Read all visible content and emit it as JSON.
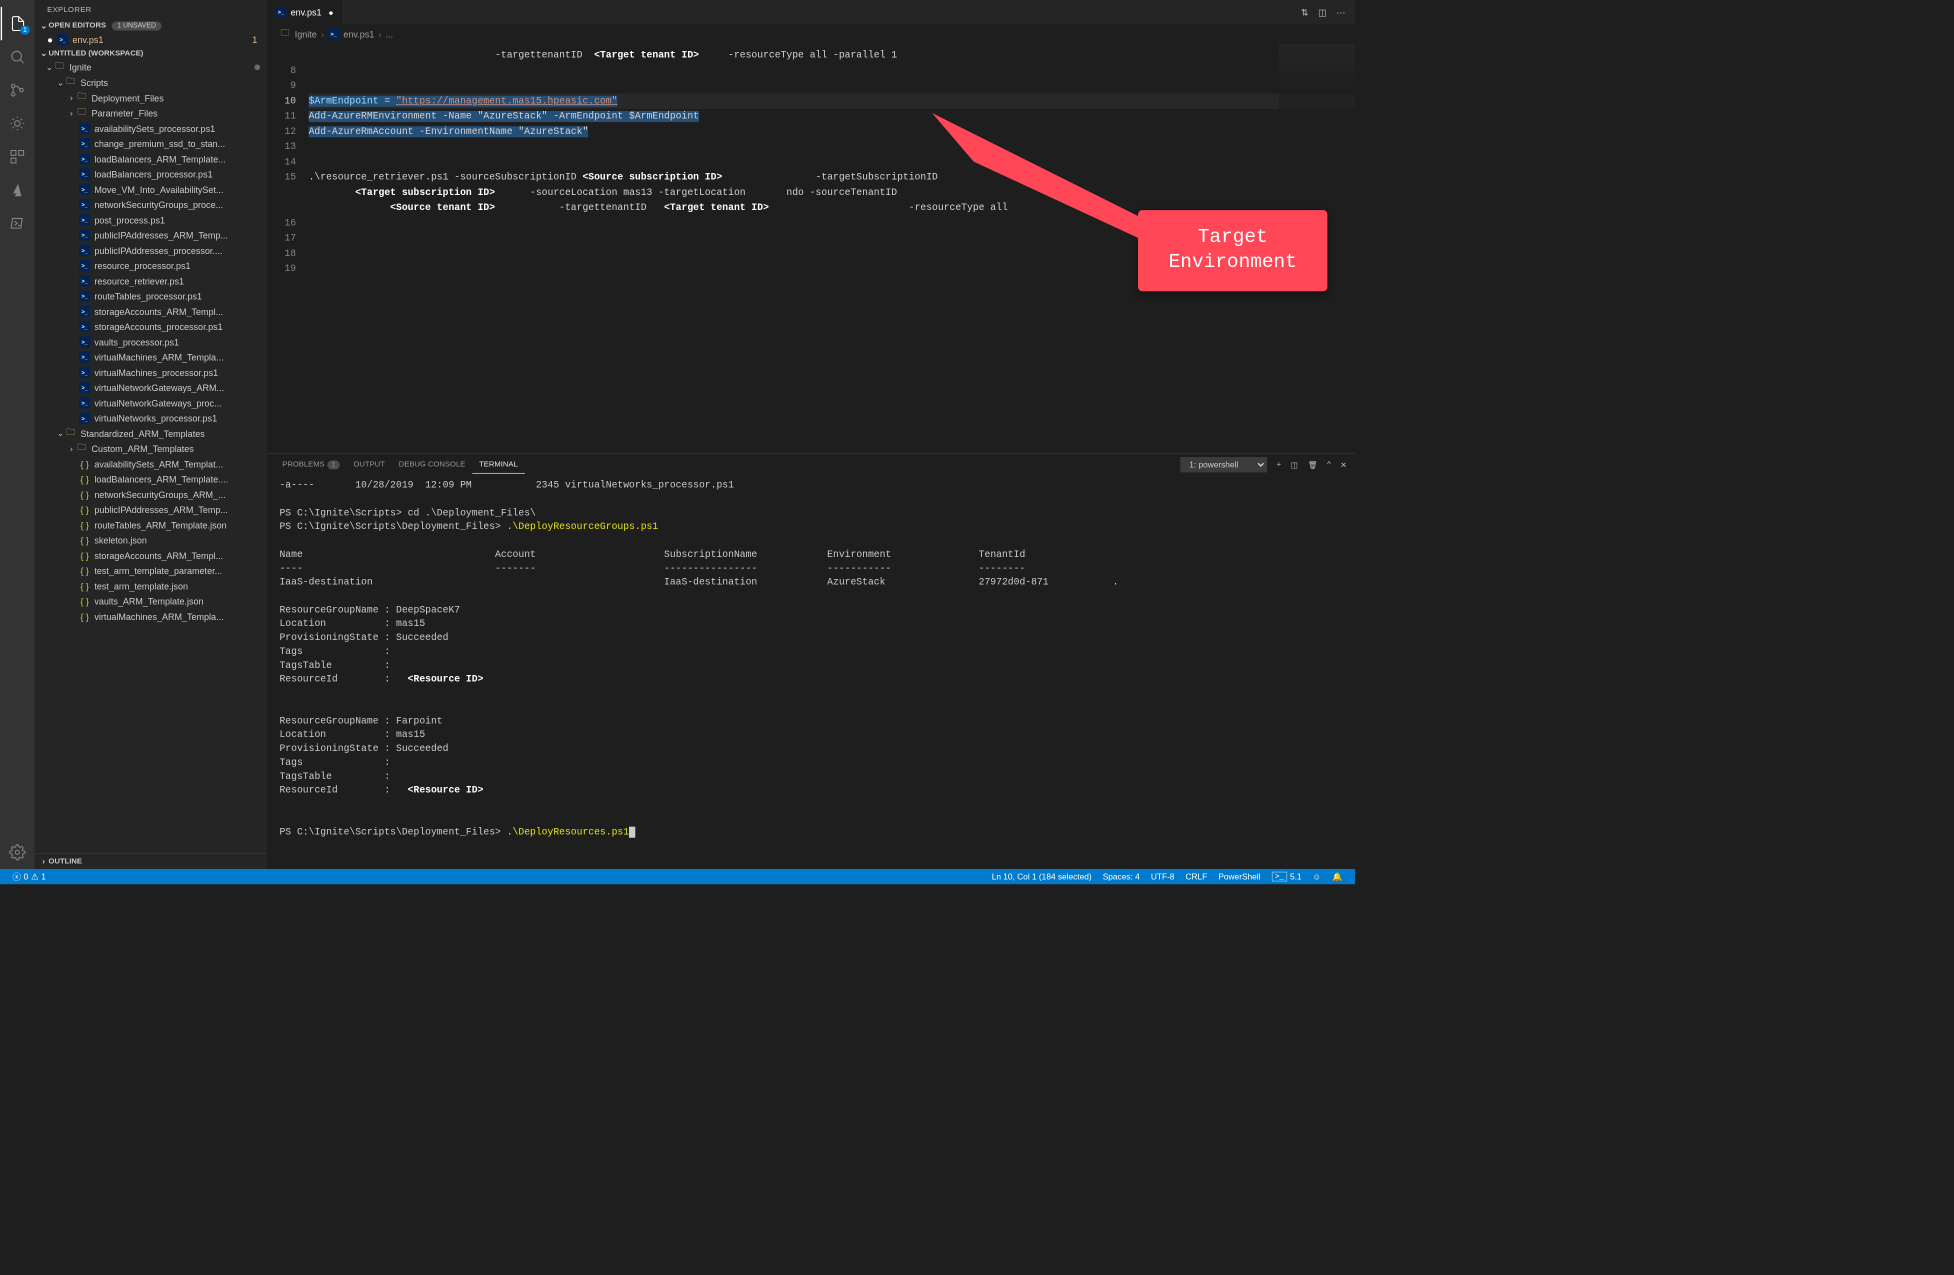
{
  "sidebar": {
    "title": "EXPLORER",
    "openEditorsLabel": "OPEN EDITORS",
    "unsavedBadge": "1 UNSAVED",
    "openEditors": [
      {
        "label": "env.ps1",
        "modified": true,
        "count": "1"
      }
    ],
    "workspaceLabel": "UNTITLED (WORKSPACE)",
    "tree": {
      "root": "Ignite",
      "scripts": "Scripts",
      "deployment": "Deployment_Files",
      "parameter": "Parameter_Files",
      "parameterFiles": [
        "availabilitySets_processor.ps1",
        "change_premium_ssd_to_stan...",
        "loadBalancers_ARM_Template...",
        "loadBalancers_processor.ps1",
        "Move_VM_Into_AvailabilitySet...",
        "networkSecurityGroups_proce...",
        "post_process.ps1",
        "publicIPAddresses_ARM_Temp...",
        "publicIPAddresses_processor....",
        "resource_processor.ps1",
        "resource_retriever.ps1",
        "routeTables_processor.ps1",
        "storageAccounts_ARM_Templ...",
        "storageAccounts_processor.ps1",
        "vaults_processor.ps1",
        "virtualMachines_ARM_Templa...",
        "virtualMachines_processor.ps1",
        "virtualNetworkGateways_ARM...",
        "virtualNetworkGateways_proc...",
        "virtualNetworks_processor.ps1"
      ],
      "stdTemplates": "Standardized_ARM_Templates",
      "customTemplates": "Custom_ARM_Templates",
      "jsonFiles": [
        "availabilitySets_ARM_Templat...",
        "loadBalancers_ARM_Template....",
        "networkSecurityGroups_ARM_...",
        "publicIPAddresses_ARM_Temp...",
        "routeTables_ARM_Template.json",
        "skeleton.json",
        "storageAccounts_ARM_Templ...",
        "test_arm_template_parameter...",
        "test_arm_template.json",
        "vaults_ARM_Template.json",
        "virtualMachines_ARM_Templa..."
      ]
    },
    "outlineLabel": "OUTLINE"
  },
  "tabs": {
    "file": "env.ps1"
  },
  "breadcrumbs": {
    "root": "Ignite",
    "file": "env.ps1",
    "more": "..."
  },
  "editor": {
    "lineStart": 8,
    "line0a": "                                -targettenantID",
    "line0b": "     -resourceType all -parallel 1",
    "ph_targetTenant": "<Target tenant ID>",
    "l10a": "$ArmEndpoint = ",
    "l10b": "\"https://management.mas15.hpeasic.com\"",
    "l11": "Add-AzureRMEnvironment -Name \"AzureStack\" -ArmEndpoint $ArmEndpoint",
    "l12": "Add-AzureRmAccount -EnvironmentName \"AzureStack\"",
    "l15a": ".\\resource_retriever.ps1 -sourceSubscriptionID ",
    "ph_srcSub": "<Source subscription ID>",
    "l15b": "                -targetSubscriptionID",
    "ph_tgtSub": "<Target subscription ID>",
    "l15c": "      -sourceLocation mas13 -targetLocation       ndo -sourceTenantID",
    "ph_srcTenant": "<Source tenant ID>",
    "l15d": "           -targettenantID   ",
    "ph_tgtTenant2": "<Target tenant ID>",
    "l15e": "                        -resourceType all"
  },
  "annotation": {
    "line1": "Target",
    "line2": "Environment"
  },
  "panel": {
    "tabs": {
      "problems": "PROBLEMS",
      "problemsCount": "1",
      "output": "OUTPUT",
      "debug": "DEBUG CONSOLE",
      "terminal": "TERMINAL"
    },
    "terminalSelect": "1: powershell",
    "content": {
      "fileRow": "-a----       10/28/2019  12:09 PM           2345 virtualNetworks_processor.ps1",
      "prompt1": "PS C:\\Ignite\\Scripts> ",
      "cmd1": "cd .\\Deployment_Files\\",
      "prompt2": "PS C:\\Ignite\\Scripts\\Deployment_Files> ",
      "cmd2": ".\\DeployResourceGroups.ps1",
      "hdrName": "Name",
      "hdrAccount": "Account",
      "hdrSub": "SubscriptionName",
      "hdrEnv": "Environment",
      "hdrTenant": "TenantId",
      "rowName": "IaaS-destination",
      "rowSub": "IaaS-destination",
      "rowEnv": "AzureStack",
      "rowTenant": "27972d0d-871",
      "rg1_name": "DeepSpaceK7",
      "rg1_loc": "mas15",
      "rg1_state": "Succeeded",
      "rg1_res": "<Resource ID>",
      "rg2_name": "Farpoint",
      "rg2_loc": "mas15",
      "rg2_state": "Succeeded",
      "rg2_res": "<Resource ID>",
      "prompt3": "PS C:\\Ignite\\Scripts\\Deployment_Files> ",
      "cmd3": ".\\DeployResources.ps1"
    }
  },
  "status": {
    "errors": "0",
    "warnings": "1",
    "cursor": "Ln 10, Col 1 (184 selected)",
    "spaces": "Spaces: 4",
    "encoding": "UTF-8",
    "eol": "CRLF",
    "lang": "PowerShell",
    "psver": "5.1"
  }
}
